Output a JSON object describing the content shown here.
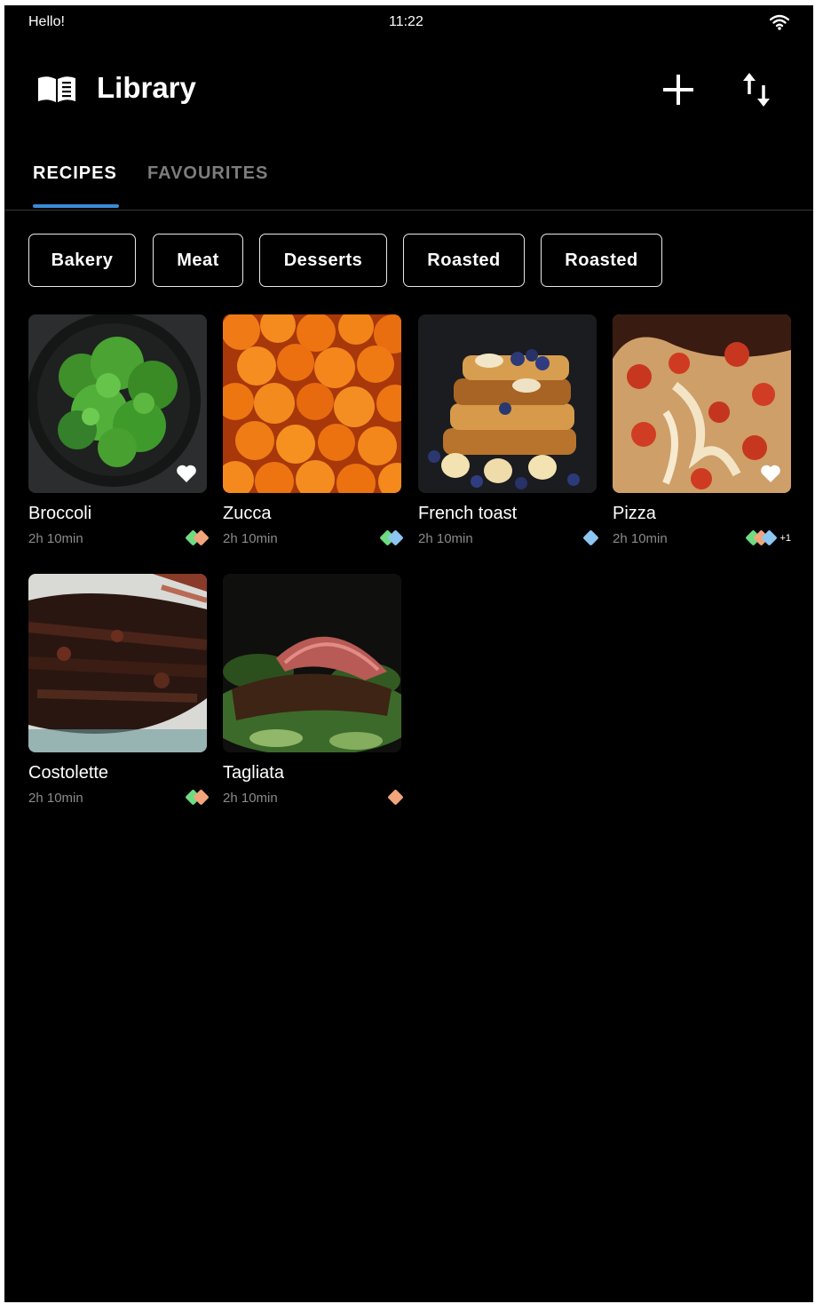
{
  "status_bar": {
    "greeting": "Hello!",
    "time": "11:22"
  },
  "app_bar": {
    "title": "Library"
  },
  "tabs": [
    {
      "label": "RECIPES",
      "selected": true
    },
    {
      "label": "FAVOURITES",
      "selected": false
    }
  ],
  "chips": [
    {
      "label": "Bakery"
    },
    {
      "label": "Meat"
    },
    {
      "label": "Desserts"
    },
    {
      "label": "Roasted"
    },
    {
      "label": "Roasted"
    }
  ],
  "tag_colors": {
    "green": "#6fdc82",
    "orange": "#f2a57d",
    "blue": "#8ec6f2"
  },
  "colors": {
    "accent": "#3b8bd9",
    "background": "#000000"
  },
  "recipes": [
    {
      "title": "Broccoli",
      "time": "2h 10min",
      "favourite": true,
      "tags": [
        "green",
        "orange"
      ]
    },
    {
      "title": "Zucca",
      "time": "2h 10min",
      "favourite": false,
      "tags": [
        "green",
        "blue"
      ]
    },
    {
      "title": "French toast",
      "time": "2h 10min",
      "favourite": false,
      "tags": [
        "blue"
      ]
    },
    {
      "title": "Pizza",
      "time": "2h 10min",
      "favourite": true,
      "tags": [
        "green",
        "orange",
        "blue"
      ],
      "more_tags": "+1"
    },
    {
      "title": "Costolette",
      "time": "2h 10min",
      "favourite": false,
      "tags": [
        "green",
        "orange"
      ]
    },
    {
      "title": "Tagliata",
      "time": "2h 10min",
      "favourite": false,
      "tags": [
        "orange"
      ]
    }
  ]
}
